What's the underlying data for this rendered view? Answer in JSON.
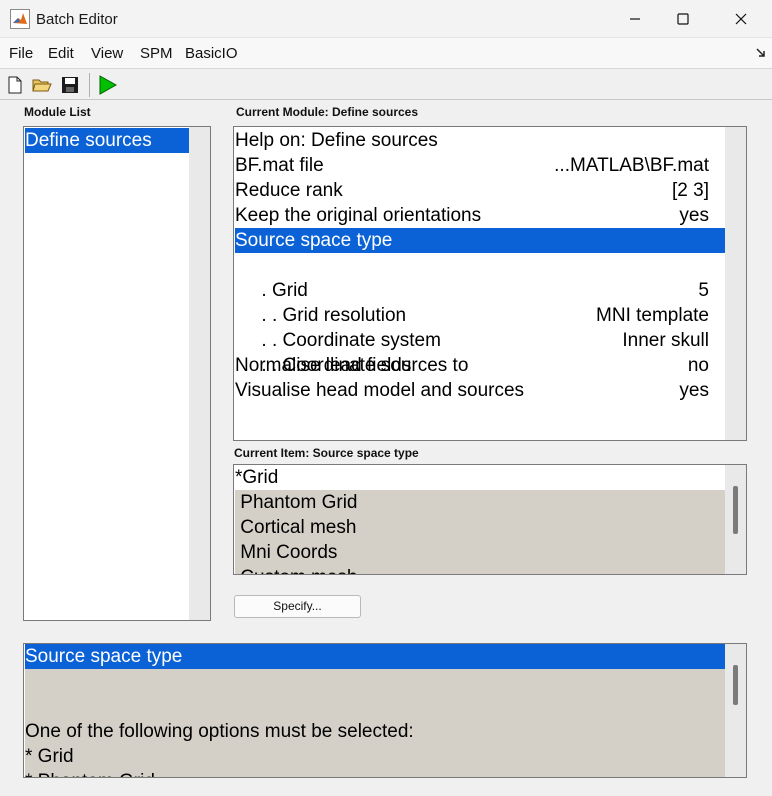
{
  "window": {
    "title": "Batch Editor"
  },
  "menu": {
    "file": "File",
    "edit": "Edit",
    "view": "View",
    "spm": "SPM",
    "basicio": "BasicIO"
  },
  "toolbar": {
    "icons": [
      "new-file-icon",
      "open-folder-icon",
      "save-icon",
      "run-icon"
    ],
    "run_color": "#00c000"
  },
  "module_list": {
    "label": "Module List",
    "items": [
      "Define sources"
    ]
  },
  "current_module": {
    "label": "Current Module: Define sources",
    "rows": [
      {
        "name": "Help on: Define sources",
        "value": ""
      },
      {
        "name": "BF.mat file",
        "value": "...MATLAB\\BF.mat"
      },
      {
        "name": "Reduce rank",
        "value": "[2 3]"
      },
      {
        "name": "Keep the original orientations",
        "value": "yes"
      },
      {
        "name": "Source space type",
        "value": ""
      },
      {
        "name": " . Grid",
        "value": ""
      },
      {
        "name": " . . Grid resolution",
        "value": "5"
      },
      {
        "name": " . . Coordinate system",
        "value": "MNI template"
      },
      {
        "name": " . . Coordinate sources to",
        "value": "Inner skull"
      },
      {
        "name": "Normalise lead fields",
        "value": "no"
      },
      {
        "name": "Visualise head model and sources",
        "value": "yes"
      }
    ]
  },
  "current_item": {
    "label": "Current Item: Source space type",
    "options": [
      "*Grid",
      " Phantom Grid",
      " Cortical mesh",
      " Mni Coords",
      " Custom mesh"
    ]
  },
  "specify_button": "Specify...",
  "help": {
    "title": "Source space type",
    "line1": "One of the following options must be selected:",
    "line2": "* Grid",
    "line3": "* Phantom Grid"
  },
  "colors": {
    "selection": "#0a62d6",
    "panel_gray": "#d4d0c8"
  }
}
